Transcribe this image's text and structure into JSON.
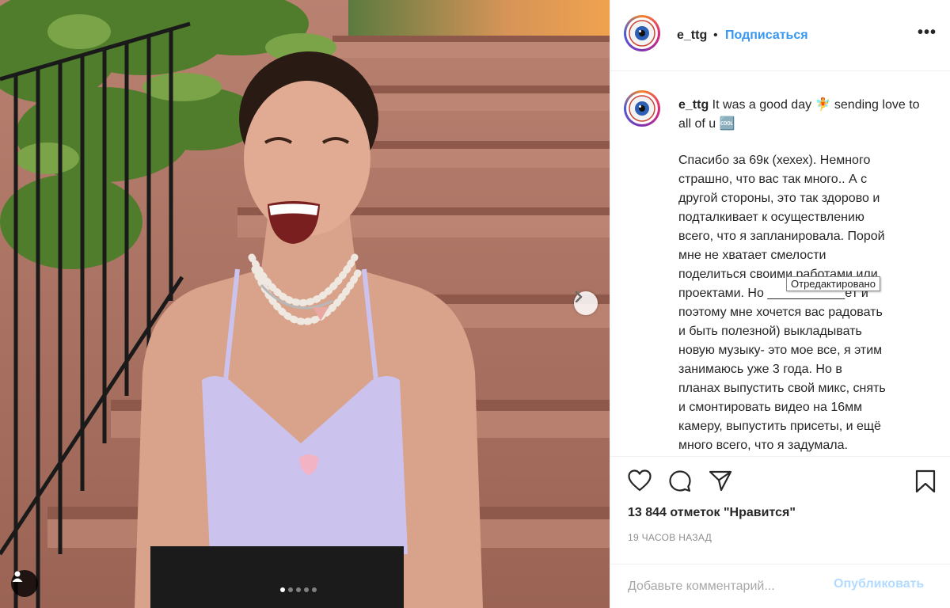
{
  "post": {
    "username": "e_ttg",
    "separator": "•",
    "follow_label": "Подписаться",
    "more_label": "•••",
    "caption_text": " It was a good day 🧚 sending love to all of u 🆒",
    "body_lines": [
      "Спасибо за 69к (хехех). Немного",
      "страшно, что вас так много.. А с",
      "другой стороны, это так здорово и",
      "подталкивает к осуществлению",
      "всего, что я запланировала. Порой",
      "мне не хватает смелости",
      "поделиться своими работами или",
      "проектами. Но ___________ёт и",
      "поэтому мне хочется вас радовать",
      "и быть полезной) выкладывать",
      "новую музыку- это мое все, я этим",
      "занимаюсь уже 3 года. Но в",
      "планах выпустить свой микс, снять",
      "и смонтировать видео на 16мм",
      "камеру, выпустить присеты, и ещё",
      "много всего, что я задумала."
    ],
    "tooltip": "Отредактировано",
    "likes": "13 844 отметок \"Нравится\"",
    "time": "19 ЧАСОВ НАЗАД",
    "comment_placeholder": "Добавьте комментарий...",
    "publish_label": "Опубликовать"
  },
  "carousel": {
    "total": 5,
    "active": 1
  },
  "icons": {
    "like": "heart-icon",
    "comment": "comment-icon",
    "share": "share-icon",
    "save": "bookmark-icon",
    "next": "chevron-right-icon",
    "tag": "user-tag-icon"
  },
  "colors": {
    "link": "#3897f0",
    "publish_disabled": "#b3dbff",
    "muted": "#8e8e8e",
    "text": "#262626"
  }
}
